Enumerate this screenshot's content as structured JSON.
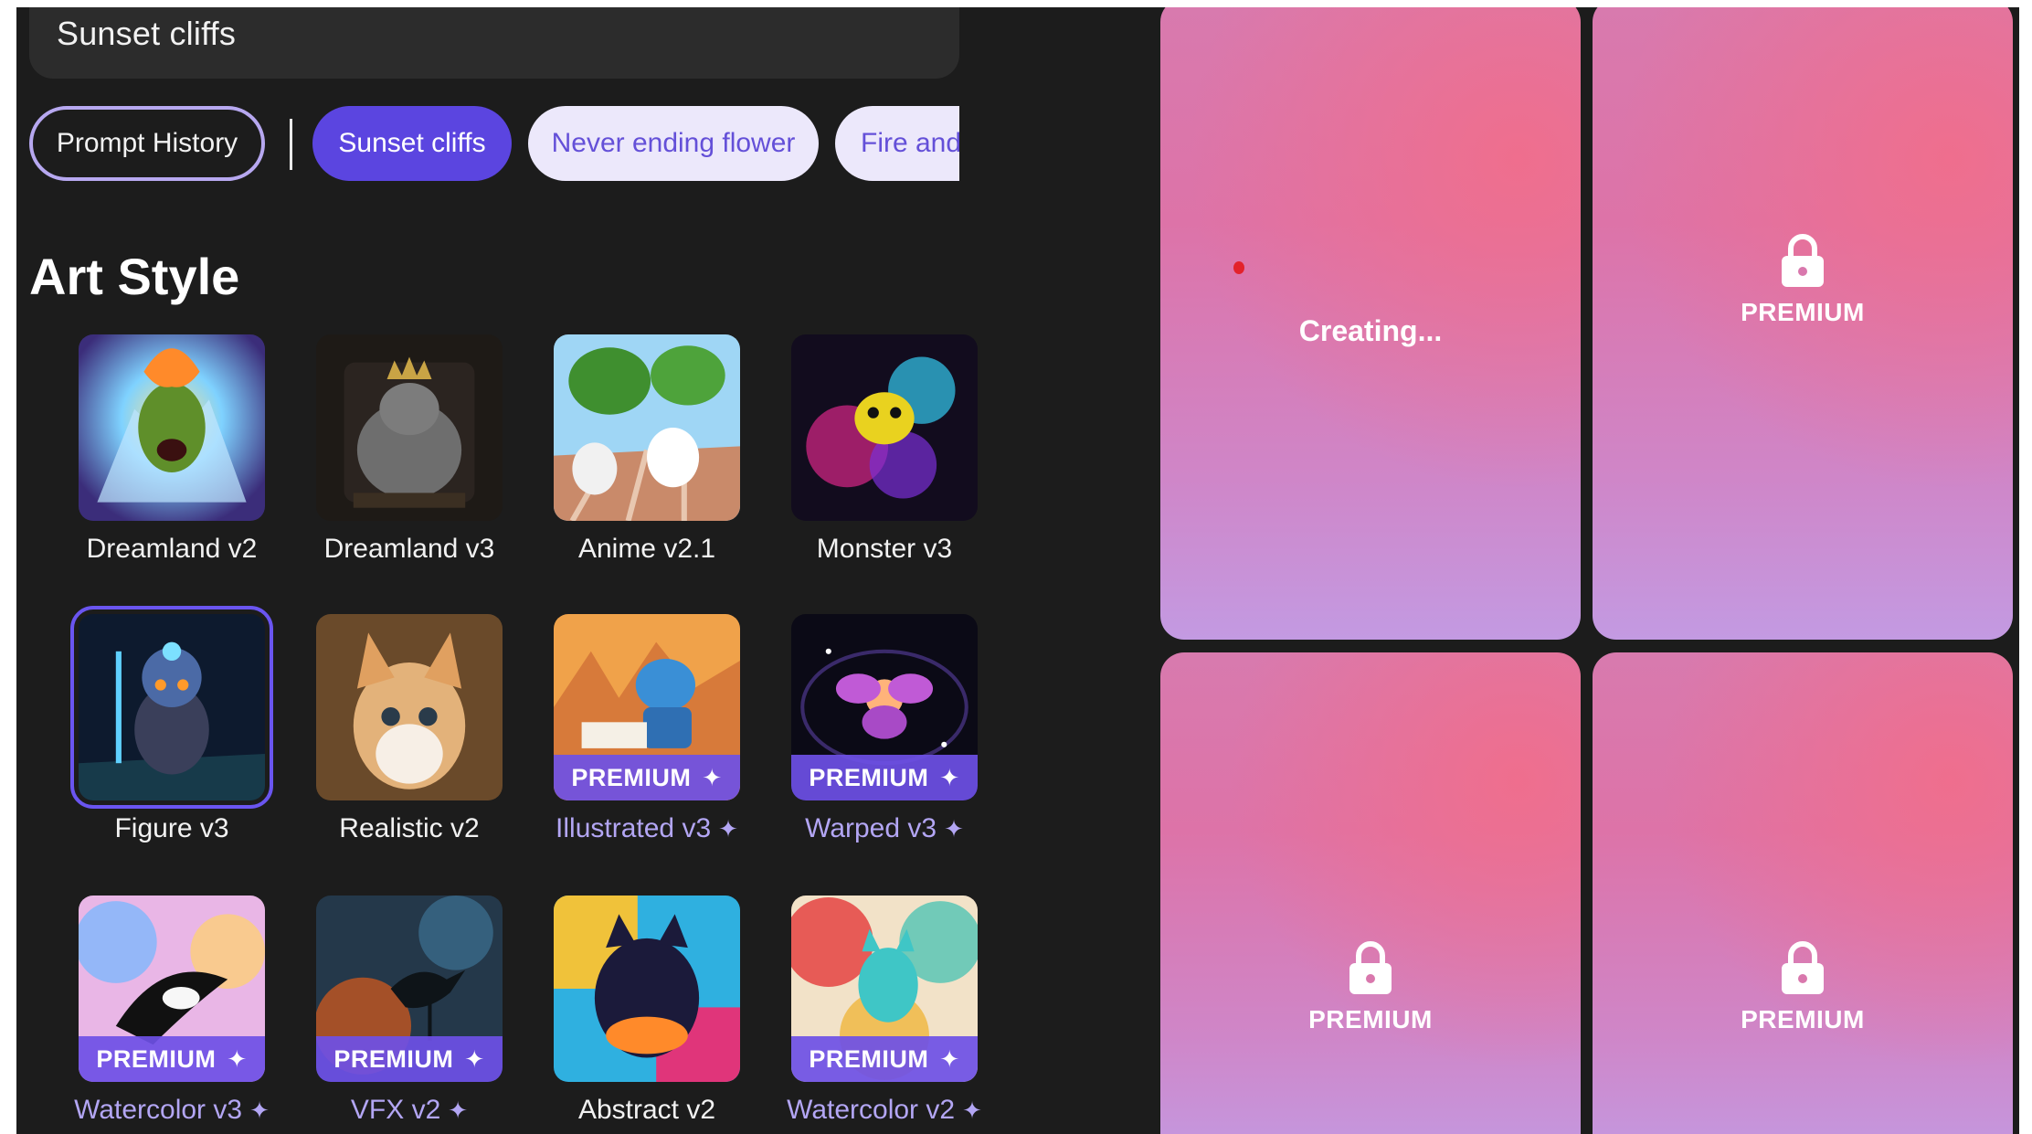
{
  "prompt": {
    "text": "Sunset cliffs"
  },
  "chips": {
    "history": "Prompt History",
    "items": [
      "Sunset cliffs",
      "Never ending flower",
      "Fire and w"
    ]
  },
  "art_style": {
    "title": "Art Style",
    "premium_badge": "PREMIUM",
    "items": [
      {
        "label": "Dreamland v2",
        "premium": false
      },
      {
        "label": "Dreamland v3",
        "premium": false
      },
      {
        "label": "Anime v2.1",
        "premium": false
      },
      {
        "label": "Monster v3",
        "premium": false
      },
      {
        "label": "Figure v3",
        "premium": false,
        "selected": true
      },
      {
        "label": "Realistic v2",
        "premium": false
      },
      {
        "label": "Illustrated v3",
        "premium": true
      },
      {
        "label": "Warped v3",
        "premium": true
      },
      {
        "label": "Watercolor v3",
        "premium": true
      },
      {
        "label": "VFX v2",
        "premium": true
      },
      {
        "label": "Abstract v2",
        "premium": false
      },
      {
        "label": "Watercolor v2",
        "premium": true
      }
    ]
  },
  "results": {
    "creating_label": "Creating...",
    "premium_label": "PREMIUM"
  },
  "icons": {
    "sparkle": "sparkle-icon",
    "lock": "lock-icon"
  },
  "colors": {
    "accent": "#5b45e0",
    "chip_soft_bg": "#ece8fb",
    "premium_text": "#b3a6f4",
    "background": "#1c1c1c"
  }
}
